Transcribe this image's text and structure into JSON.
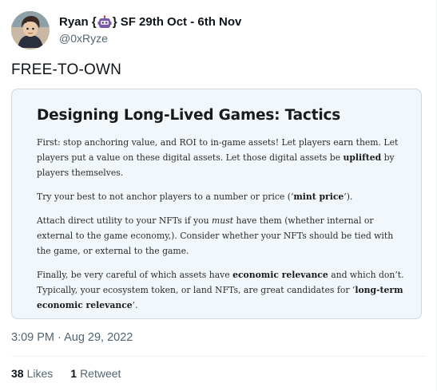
{
  "author": {
    "name_before_emoji": "Ryan {",
    "emoji": "robot-emoji",
    "name_after_emoji": "} SF 29th Oct - 6th Nov",
    "handle": "@0xRyze"
  },
  "tweet_text": "FREE-TO-OWN",
  "card": {
    "title": "Designing Long-Lived Games: Tactics",
    "p1": {
      "a": "First: stop anchoring value, and ROI to in-game assets! Let players earn them. Let players put a value on these digital assets. Let those digital assets be ",
      "b": "uplifted",
      "c": " by players themselves."
    },
    "p2": {
      "a": "Try your best to not anchor players to a number or price (‘",
      "b": "mint price",
      "c": "’)."
    },
    "p3": {
      "a": "Attach direct utility to your NFTs if you ",
      "b": "must",
      "c": " have them (whether internal or external to the game economy,). Consider whether your NFTs should be tied with the game, or external to the game."
    },
    "p4": {
      "a": "Finally, be very careful of which assets have ",
      "b": "economic relevance",
      "c": " and which don’t. Typically, your ecosystem token, or land NFTs, are great candidates for ‘",
      "d": "long-term economic relevance",
      "e": "’."
    }
  },
  "timestamp": "3:09 PM · Aug 29, 2022",
  "stats": {
    "likes_count": "38",
    "likes_label": "Likes",
    "retweets_count": "1",
    "retweets_label": "Retweet"
  },
  "colors": {
    "secondary_text": "#536471",
    "card_bg": "#f1f7fb",
    "card_border": "#cfd9de"
  }
}
